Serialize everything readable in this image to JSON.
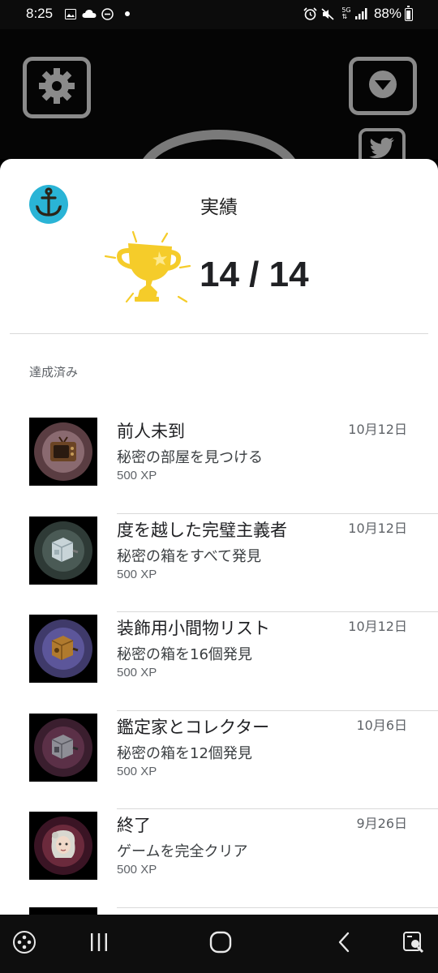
{
  "status_bar": {
    "time": "8:25",
    "battery": "88%",
    "icons": [
      "gallery-icon",
      "cloud-icon",
      "dnd-icon",
      "dot-icon",
      "alarm-icon",
      "mute-icon",
      "5g-icon",
      "signal-icon",
      "battery-icon"
    ]
  },
  "game": {
    "buttons": [
      "gear-icon",
      "download-icon",
      "twitter-icon"
    ]
  },
  "sheet": {
    "title": "実績",
    "score": "14 / 14",
    "section_label": "達成済み",
    "accent": "#2ab4d6",
    "trophy_color": "#f5cc2a"
  },
  "achievements": [
    {
      "name": "前人未到",
      "desc": "秘密の部屋を見つける",
      "xp": "500 XP",
      "date": "10月12日",
      "ring": "#5a3d42",
      "inner": "#8a6a70",
      "icon": "tv-icon"
    },
    {
      "name": "度を越した完璧主義者",
      "desc": "秘密の箱をすべて発見",
      "xp": "500 XP",
      "date": "10月12日",
      "ring": "#2e3a36",
      "inner": "#4a5a55",
      "icon": "box-icon"
    },
    {
      "name": "装飾用小間物リスト",
      "desc": "秘密の箱を16個発見",
      "xp": "500 XP",
      "date": "10月12日",
      "ring": "#3f3a6a",
      "inner": "#5c569a",
      "icon": "box-icon"
    },
    {
      "name": "鑑定家とコレクター",
      "desc": "秘密の箱を12個発見",
      "xp": "500 XP",
      "date": "10月6日",
      "ring": "#3a1e2e",
      "inner": "#5b3047",
      "icon": "box-icon"
    },
    {
      "name": "終了",
      "desc": "ゲームを完全クリア",
      "xp": "500 XP",
      "date": "9月26日",
      "ring": "#3a1424",
      "inner": "#6b2a3c",
      "icon": "character-icon"
    }
  ],
  "nav": {
    "buttons": [
      "games-icon",
      "recents-icon",
      "home-icon",
      "back-icon",
      "screenshot-icon"
    ]
  }
}
